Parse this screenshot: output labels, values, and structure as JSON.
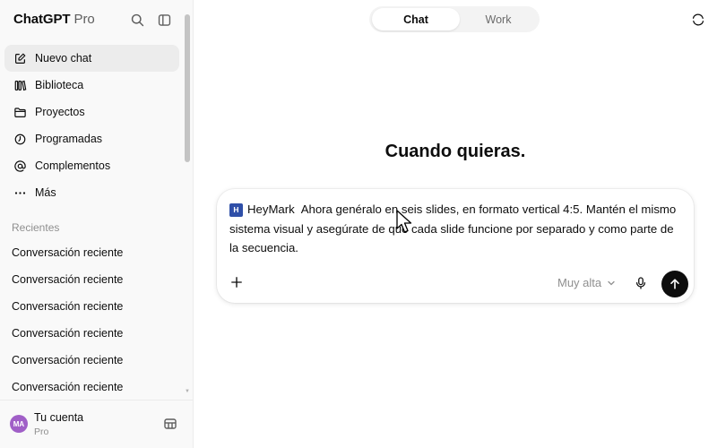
{
  "app": {
    "brand_name": "ChatGPT",
    "brand_suffix": "Pro"
  },
  "sidebar": {
    "nav": [
      {
        "label": "Nuevo chat",
        "icon": "edit-icon",
        "active": true
      },
      {
        "label": "Biblioteca",
        "icon": "library-icon"
      },
      {
        "label": "Proyectos",
        "icon": "folder-icon"
      },
      {
        "label": "Programadas",
        "icon": "clock-icon"
      },
      {
        "label": "Complementos",
        "icon": "at-icon"
      },
      {
        "label": "Más",
        "icon": "more-icon"
      }
    ],
    "recents_title": "Recientes",
    "recents": [
      "Conversación reciente",
      "Conversación reciente",
      "Conversación reciente",
      "Conversación reciente",
      "Conversación reciente",
      "Conversación reciente"
    ],
    "account": {
      "initials": "MA",
      "name": "Tu cuenta",
      "plan": "Pro",
      "avatar_color": "#a05fc7"
    }
  },
  "main": {
    "mode_tabs": {
      "chat": "Chat",
      "work": "Work",
      "selected": "Chat"
    },
    "headline": "Cuando quieras.",
    "composer": {
      "mention_badge": "H",
      "mention_name": "HeyMark",
      "mention_color": "#2f4fa8",
      "prompt_text": "Ahora genéralo en seis slides, en formato vertical 4:5. Mantén el mismo sistema visual y asegúrate de que cada slide funcione por separado y como parte de la secuencia.",
      "effort_label": "Muy alta"
    }
  }
}
